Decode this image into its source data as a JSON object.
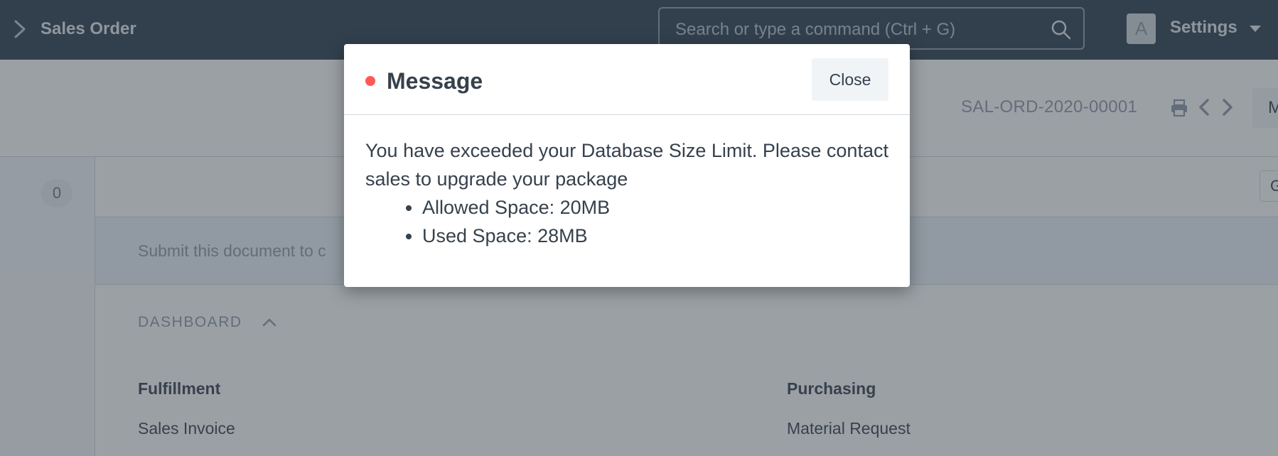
{
  "navbar": {
    "title": "Sales Order",
    "search_placeholder": "Search or type a command (Ctrl + G)",
    "avatar_initial": "A",
    "settings_label": "Settings"
  },
  "page_header": {
    "doc_id": "SAL-ORD-2020-00001",
    "menu_label": "M"
  },
  "sidebar": {
    "count": "0"
  },
  "form": {
    "toolbar_btn_label": "G",
    "submit_banner": "Submit this document to c",
    "dashboard_label": "DASHBOARD",
    "groups": [
      {
        "title": "Fulfillment",
        "links": [
          "Sales Invoice"
        ]
      },
      {
        "title": "Purchasing",
        "links": [
          "Material Request"
        ]
      }
    ]
  },
  "modal": {
    "indicator_color": "#ff5858",
    "title": "Message",
    "close_label": "Close",
    "message": "You have exceeded your Database Size Limit. Please contact sales to upgrade your package",
    "items": [
      "Allowed Space: 20MB",
      "Used Space: 28MB"
    ]
  },
  "colors": {
    "navbar_bg": "#2c3e50",
    "indicator_red": "#ff5858"
  }
}
